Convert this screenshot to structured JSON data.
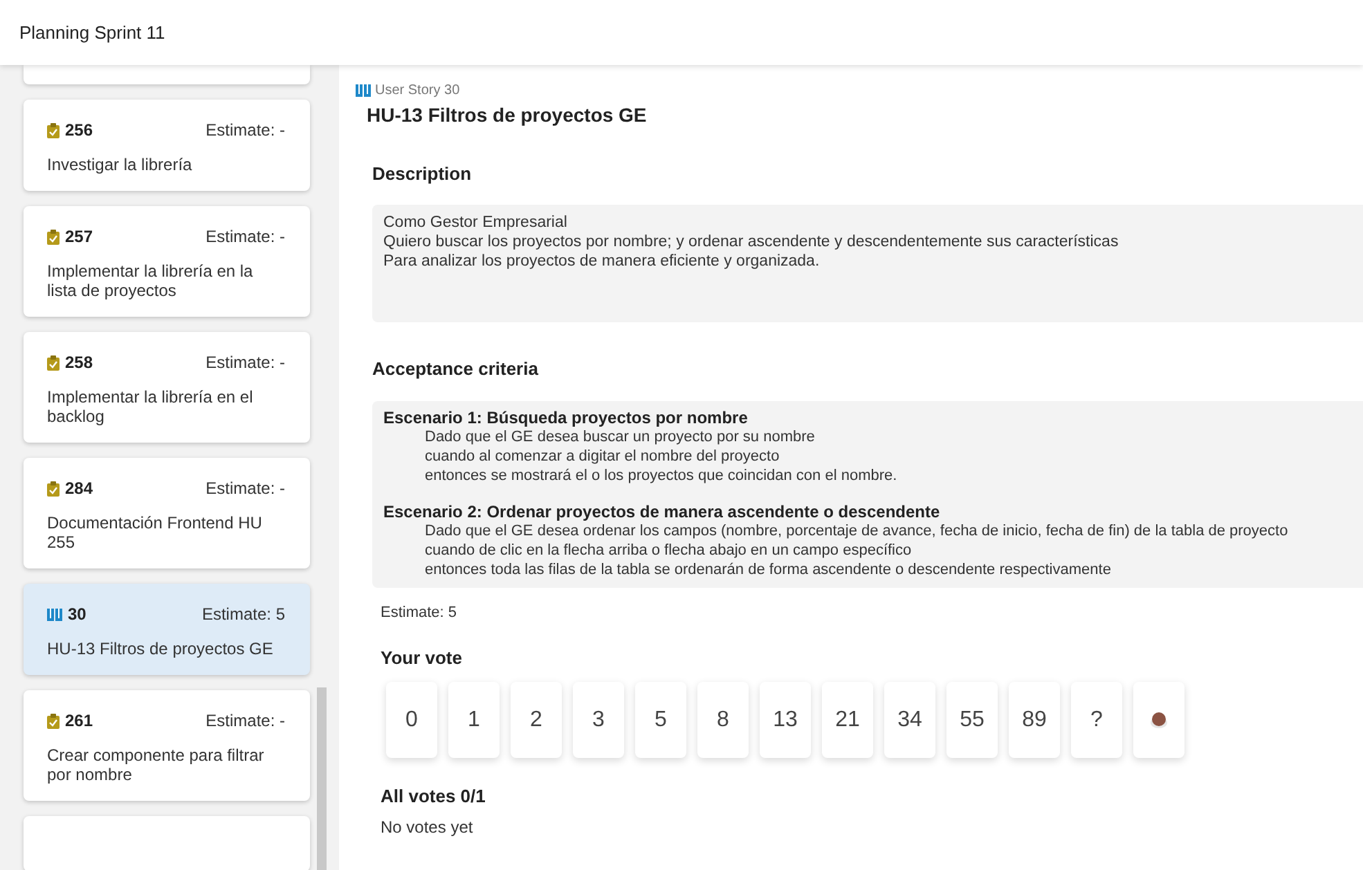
{
  "window": {
    "title": "Planning Sprint 11"
  },
  "sidebar": {
    "items": [
      {
        "kind": "task",
        "id": "256",
        "estimate": "Estimate: -",
        "title": "Investigar la librería",
        "selected": false
      },
      {
        "kind": "task",
        "id": "257",
        "estimate": "Estimate: -",
        "title": "Implementar la librería en la lista de proyectos",
        "selected": false
      },
      {
        "kind": "task",
        "id": "258",
        "estimate": "Estimate: -",
        "title": "Implementar la librería en el backlog",
        "selected": false
      },
      {
        "kind": "task",
        "id": "284",
        "estimate": "Estimate: -",
        "title": "Documentación Frontend HU 255",
        "selected": false
      },
      {
        "kind": "story",
        "id": "30",
        "estimate": "Estimate: 5",
        "title": "HU-13 Filtros de proyectos GE",
        "selected": true
      },
      {
        "kind": "task",
        "id": "261",
        "estimate": "Estimate: -",
        "title": "Crear componente para filtrar por nombre",
        "selected": false
      }
    ]
  },
  "detail": {
    "type": "User Story 30",
    "title": "HU-13 Filtros de proyectos GE",
    "description_heading": "Description",
    "description": [
      "Como Gestor Empresarial",
      "Quiero buscar los proyectos por nombre; y ordenar ascendente y descendentemente sus características",
      "Para analizar los proyectos de manera eficiente y organizada."
    ],
    "criteria_heading": "Acceptance criteria",
    "scenarios": [
      {
        "title": "Escenario 1: Búsqueda proyectos por nombre",
        "lines": [
          "Dado que el GE desea buscar un proyecto por su nombre",
          "cuando al comenzar a digitar el nombre del proyecto",
          "entonces se mostrará el o los proyectos que coincidan con el nombre."
        ]
      },
      {
        "title": "Escenario 2: Ordenar proyectos de manera ascendente o descendente",
        "lines": [
          "Dado que el GE desea ordenar los campos (nombre, porcentaje de avance, fecha de inicio, fecha de fin) de la tabla de proyecto",
          "cuando de clic en la flecha arriba o flecha abajo en un campo específico",
          "entonces toda las filas de la tabla se ordenarán de forma ascendente o descendente respectivamente"
        ]
      }
    ],
    "estimate": "Estimate: 5",
    "vote_heading": "Your vote",
    "cards": [
      {
        "kind": "number",
        "label": "0",
        "selected": false
      },
      {
        "kind": "number",
        "label": "1",
        "selected": false
      },
      {
        "kind": "number",
        "label": "2",
        "selected": false
      },
      {
        "kind": "number",
        "label": "3",
        "selected": false
      },
      {
        "kind": "number",
        "label": "5",
        "selected": false
      },
      {
        "kind": "number",
        "label": "8",
        "selected": false
      },
      {
        "kind": "number",
        "label": "13",
        "selected": false
      },
      {
        "kind": "number",
        "label": "21",
        "selected": false
      },
      {
        "kind": "number",
        "label": "34",
        "selected": false
      },
      {
        "kind": "number",
        "label": "55",
        "selected": false
      },
      {
        "kind": "number",
        "label": "89",
        "selected": false
      },
      {
        "kind": "number",
        "label": "?",
        "selected": false
      },
      {
        "kind": "coffee",
        "selected": false
      }
    ],
    "votes_heading": "All votes 0/1",
    "votes_text": "No votes yet"
  }
}
